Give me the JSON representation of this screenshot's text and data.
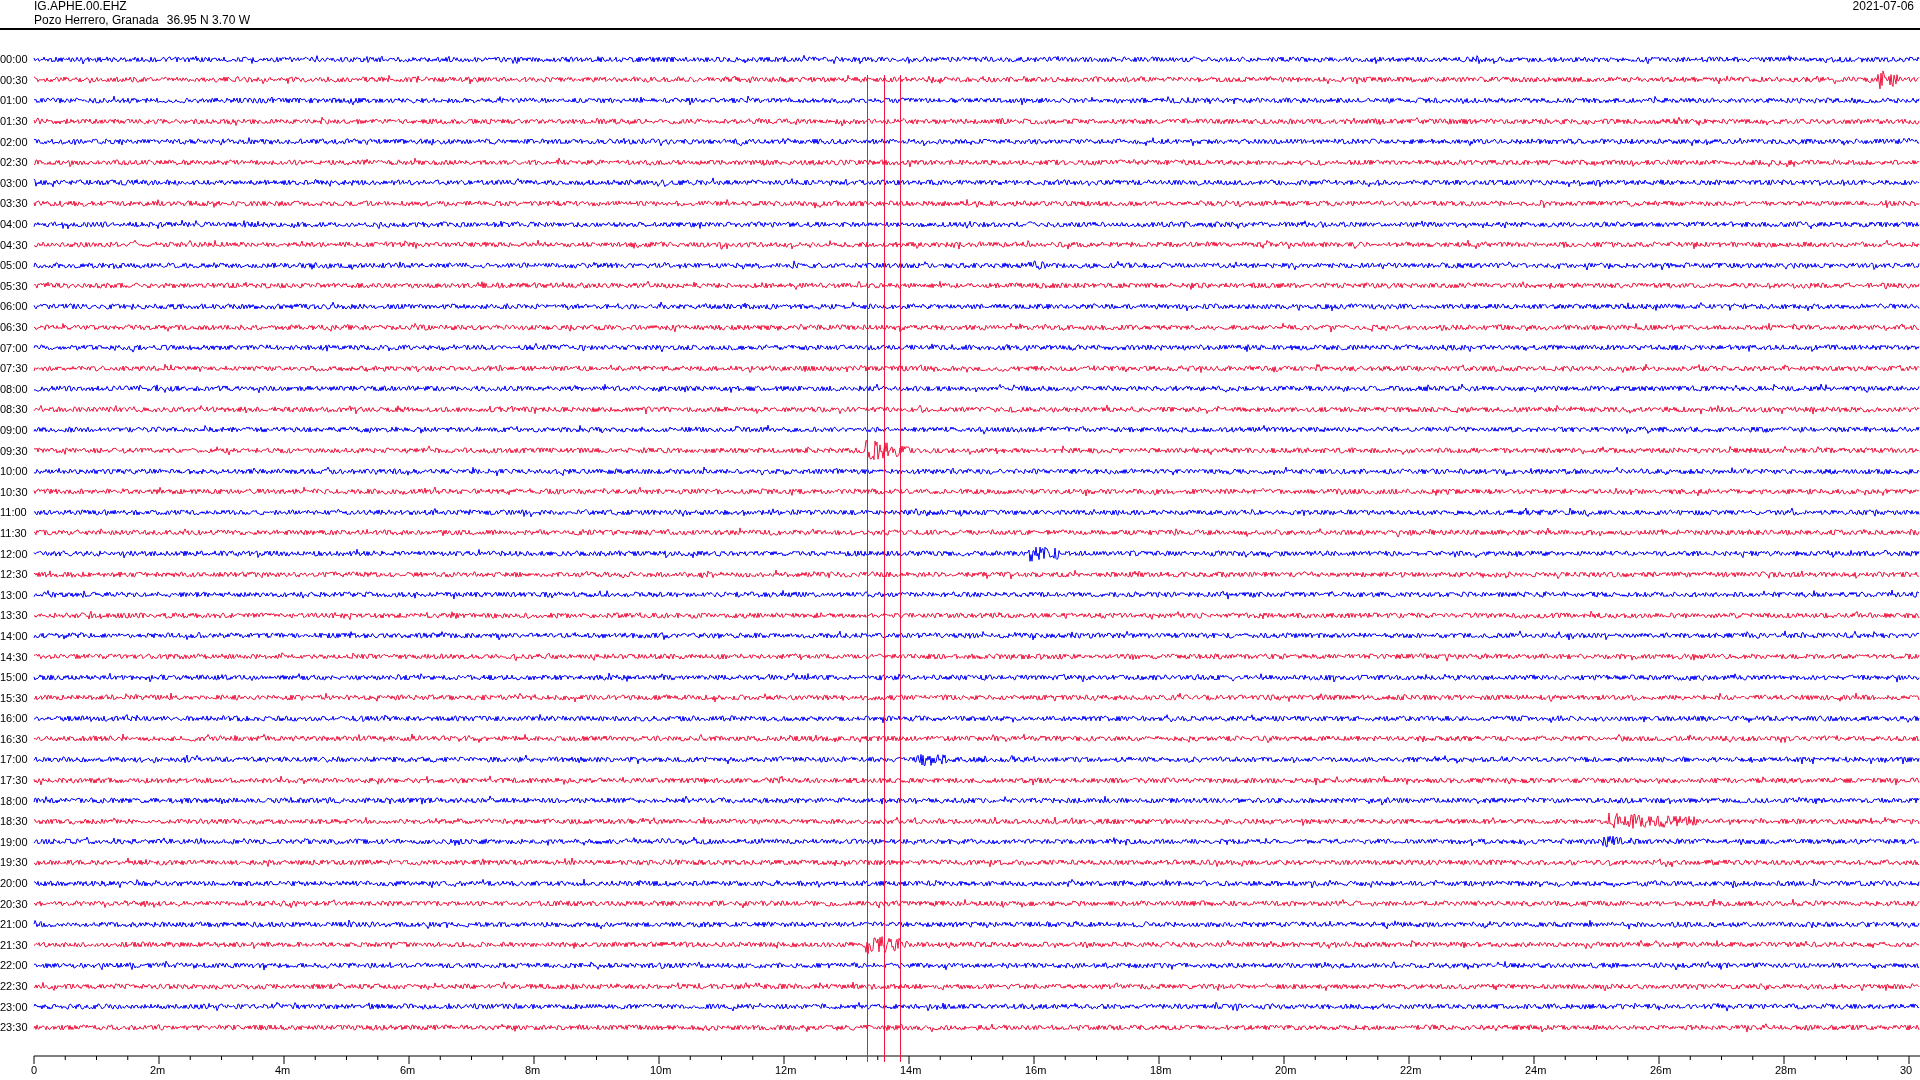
{
  "header": {
    "station": "IG.APHE.00.EHZ",
    "location": "Pozo Herrero, Granada",
    "coordinates": "36.95 N 3.70 W",
    "date": "2021-07-06"
  },
  "rows": [
    {
      "label": "00:00",
      "color": "#0000ff"
    },
    {
      "label": "00:30",
      "color": "#f0163f"
    },
    {
      "label": "01:00",
      "color": "#0000ff"
    },
    {
      "label": "01:30",
      "color": "#f0163f"
    },
    {
      "label": "02:00",
      "color": "#0000ff"
    },
    {
      "label": "02:30",
      "color": "#f0163f"
    },
    {
      "label": "03:00",
      "color": "#0000ff"
    },
    {
      "label": "03:30",
      "color": "#f0163f"
    },
    {
      "label": "04:00",
      "color": "#0000ff"
    },
    {
      "label": "04:30",
      "color": "#f0163f"
    },
    {
      "label": "05:00",
      "color": "#0000ff"
    },
    {
      "label": "05:30",
      "color": "#f0163f"
    },
    {
      "label": "06:00",
      "color": "#0000ff"
    },
    {
      "label": "06:30",
      "color": "#f0163f"
    },
    {
      "label": "07:00",
      "color": "#0000ff"
    },
    {
      "label": "07:30",
      "color": "#f0163f"
    },
    {
      "label": "08:00",
      "color": "#0000ff"
    },
    {
      "label": "08:30",
      "color": "#f0163f"
    },
    {
      "label": "09:00",
      "color": "#0000ff"
    },
    {
      "label": "09:30",
      "color": "#f0163f"
    },
    {
      "label": "10:00",
      "color": "#0000ff"
    },
    {
      "label": "10:30",
      "color": "#f0163f"
    },
    {
      "label": "11:00",
      "color": "#0000ff"
    },
    {
      "label": "11:30",
      "color": "#f0163f"
    },
    {
      "label": "12:00",
      "color": "#0000ff"
    },
    {
      "label": "12:30",
      "color": "#f0163f"
    },
    {
      "label": "13:00",
      "color": "#0000ff"
    },
    {
      "label": "13:30",
      "color": "#f0163f"
    },
    {
      "label": "14:00",
      "color": "#0000ff"
    },
    {
      "label": "14:30",
      "color": "#f0163f"
    },
    {
      "label": "15:00",
      "color": "#0000ff"
    },
    {
      "label": "15:30",
      "color": "#f0163f"
    },
    {
      "label": "16:00",
      "color": "#0000ff"
    },
    {
      "label": "16:30",
      "color": "#f0163f"
    },
    {
      "label": "17:00",
      "color": "#0000ff"
    },
    {
      "label": "17:30",
      "color": "#f0163f"
    },
    {
      "label": "18:00",
      "color": "#0000ff"
    },
    {
      "label": "18:30",
      "color": "#f0163f"
    },
    {
      "label": "19:00",
      "color": "#0000ff"
    },
    {
      "label": "19:30",
      "color": "#f0163f"
    },
    {
      "label": "20:00",
      "color": "#0000ff"
    },
    {
      "label": "20:30",
      "color": "#f0163f"
    },
    {
      "label": "21:00",
      "color": "#0000ff"
    },
    {
      "label": "21:30",
      "color": "#f0163f"
    },
    {
      "label": "22:00",
      "color": "#0000ff"
    },
    {
      "label": "22:30",
      "color": "#f0163f"
    },
    {
      "label": "23:00",
      "color": "#0000ff"
    },
    {
      "label": "23:30",
      "color": "#f0163f"
    }
  ],
  "x_axis": {
    "labels": [
      "0",
      "2m",
      "4m",
      "6m",
      "8m",
      "10m",
      "12m",
      "14m",
      "16m",
      "18m",
      "20m",
      "22m",
      "24m",
      "26m",
      "28m",
      "30"
    ]
  }
}
